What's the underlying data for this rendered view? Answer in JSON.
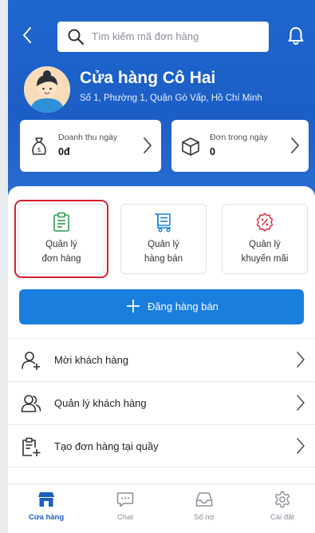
{
  "header": {
    "search_placeholder": "Tìm kiếm mã đơn hàng",
    "store_name": "Cửa hàng Cô Hai",
    "store_address": "Số 1, Phường 1, Quận Gò Vấp, Hồ Chí Minh"
  },
  "stats": [
    {
      "label": "Doanh thu ngày",
      "value": "0đ",
      "icon": "money-bag-icon"
    },
    {
      "label": "Đơn trong ngày",
      "value": "0",
      "icon": "box-icon"
    }
  ],
  "tiles": [
    {
      "line1": "Quản lý",
      "line2": "đơn hàng",
      "icon": "clipboard-icon",
      "color": "#2e9b57",
      "highlighted": true
    },
    {
      "line1": "Quản lý",
      "line2": "hàng bán",
      "icon": "cart-icon",
      "color": "#1a7ede"
    },
    {
      "line1": "Quản lý",
      "line2": "khuyến mãi",
      "icon": "discount-badge-icon",
      "color": "#e0303c"
    }
  ],
  "post_button": {
    "label": "Đăng hàng bán"
  },
  "menu": [
    {
      "label": "Mời khách hàng",
      "icon": "add-user-icon"
    },
    {
      "label": "Quản lý khách hàng",
      "icon": "users-icon"
    },
    {
      "label": "Tạo đơn hàng tại quầy",
      "icon": "add-order-icon"
    }
  ],
  "nav": [
    {
      "label": "Cửa hàng",
      "icon": "store-icon",
      "active": true
    },
    {
      "label": "Chat",
      "icon": "chat-icon"
    },
    {
      "label": "Sổ nợ",
      "icon": "inbox-icon"
    },
    {
      "label": "Cài đặt",
      "icon": "settings-gear-icon"
    }
  ],
  "colors": {
    "primary": "#1b5ec6",
    "button": "#1a7ede",
    "highlight": "#d6202c"
  }
}
